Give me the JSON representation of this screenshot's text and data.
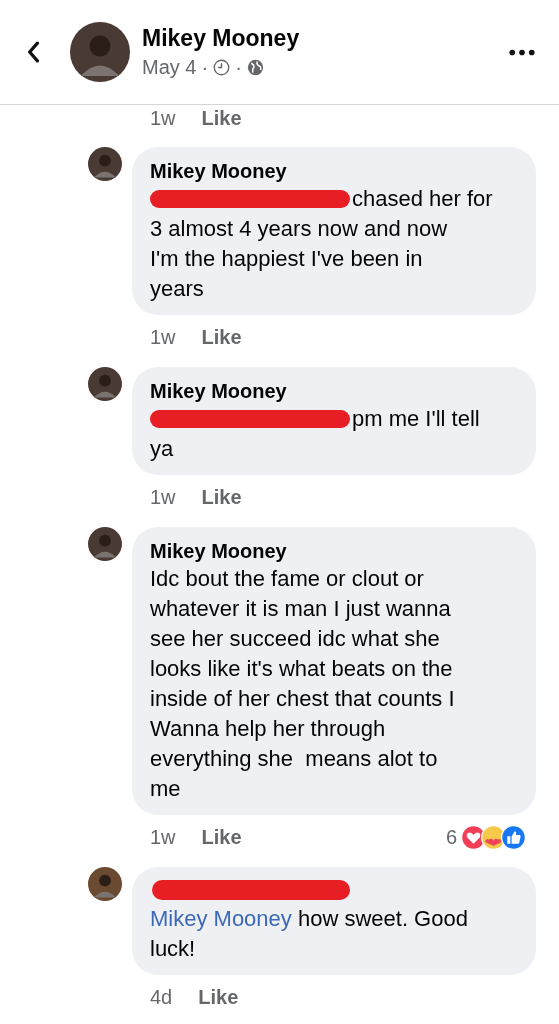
{
  "header": {
    "name": "Mikey Mooney",
    "date": "May 4",
    "separators": [
      "·",
      "·"
    ]
  },
  "previous_meta": {
    "time": "1w",
    "like": "Like"
  },
  "comments": [
    {
      "author": "Mikey Mooney",
      "author_redacted": false,
      "mention_redacted": true,
      "first_line": "chased her for",
      "text": "3 almost 4 years now and now\nI'm the happiest I've been in\nyears",
      "time": "1w",
      "like": "Like"
    },
    {
      "author": "Mikey Mooney",
      "author_redacted": false,
      "mention_redacted": true,
      "first_line": "pm me I'll tell",
      "text": "ya",
      "time": "1w",
      "like": "Like"
    },
    {
      "author": "Mikey Mooney",
      "author_redacted": false,
      "mention_redacted": false,
      "text": "Idc bout the fame or clout or\nwhatever it is man I just wanna\nsee her succeed idc what she\nlooks like it's what beats on the\ninside of her chest that counts I\nWanna help her through\neverything she  means alot to\nme",
      "time": "1w",
      "like": "Like",
      "reactions": {
        "count": "6"
      }
    },
    {
      "author_redacted": true,
      "mention_redacted": false,
      "mention": "Mikey Mooney",
      "text": " how sweet. Good\nluck!",
      "time": "4d",
      "like": "Like"
    }
  ]
}
